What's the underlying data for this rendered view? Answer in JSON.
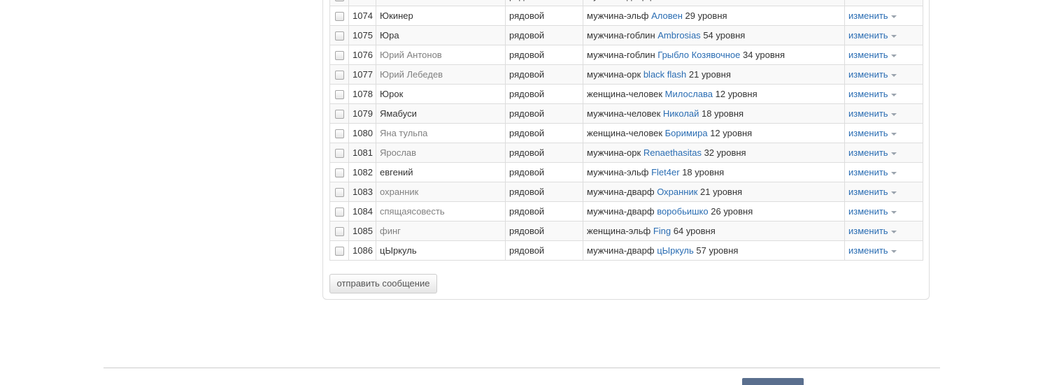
{
  "members": [
    {
      "num": "",
      "name": "",
      "name_link": false,
      "rank": "рядовой",
      "race": "мужчина-дварф",
      "char": "",
      "level": "",
      "action": "изменить"
    },
    {
      "num": "1074",
      "name": "Юкинер",
      "name_link": true,
      "rank": "рядовой",
      "race": "мужчина-эльф",
      "char": "Аловен",
      "level": "29 уровня",
      "action": "изменить"
    },
    {
      "num": "1075",
      "name": "Юра",
      "name_link": true,
      "rank": "рядовой",
      "race": "мужчина-гоблин",
      "char": "Ambrosias",
      "level": "54 уровня",
      "action": "изменить"
    },
    {
      "num": "1076",
      "name": "Юрий Антонов",
      "name_link": false,
      "rank": "рядовой",
      "race": "мужчина-гоблин",
      "char": "Грыбло Козявочное",
      "level": "34 уровня",
      "action": "изменить"
    },
    {
      "num": "1077",
      "name": "Юрий Лебедев",
      "name_link": false,
      "rank": "рядовой",
      "race": "мужчина-орк",
      "char": "black flash",
      "level": "21 уровня",
      "action": "изменить"
    },
    {
      "num": "1078",
      "name": "Юрок",
      "name_link": true,
      "rank": "рядовой",
      "race": "женщина-человек",
      "char": "Милослава",
      "level": "12 уровня",
      "action": "изменить"
    },
    {
      "num": "1079",
      "name": "Ямабуси",
      "name_link": true,
      "rank": "рядовой",
      "race": "мужчина-человек",
      "char": "Николай",
      "level": "18 уровня",
      "action": "изменить"
    },
    {
      "num": "1080",
      "name": "Яна тульпа",
      "name_link": false,
      "rank": "рядовой",
      "race": "женщина-человек",
      "char": "Боримира",
      "level": "12 уровня",
      "action": "изменить"
    },
    {
      "num": "1081",
      "name": "Ярослав",
      "name_link": false,
      "rank": "рядовой",
      "race": "мужчина-орк",
      "char": "Renaethasitas",
      "level": "32 уровня",
      "action": "изменить"
    },
    {
      "num": "1082",
      "name": "евгений",
      "name_link": true,
      "rank": "рядовой",
      "race": "мужчина-эльф",
      "char": "Flet4er",
      "level": "18 уровня",
      "action": "изменить"
    },
    {
      "num": "1083",
      "name": "охранник",
      "name_link": false,
      "rank": "рядовой",
      "race": "мужчина-дварф",
      "char": "Охранник",
      "level": "21 уровня",
      "action": "изменить"
    },
    {
      "num": "1084",
      "name": "спящаясовесть",
      "name_link": false,
      "rank": "рядовой",
      "race": "мужчина-дварф",
      "char": "воробьишко",
      "level": "26 уровня",
      "action": "изменить"
    },
    {
      "num": "1085",
      "name": "финг",
      "name_link": false,
      "rank": "рядовой",
      "race": "женщина-эльф",
      "char": "Fing",
      "level": "64 уровня",
      "action": "изменить"
    },
    {
      "num": "1086",
      "name": "цЫркуль",
      "name_link": true,
      "rank": "рядовой",
      "race": "мужчина-дварф",
      "char": "цЫркуль",
      "level": "57 уровня",
      "action": "изменить"
    }
  ],
  "send_button": "отправить сообщение",
  "colors": {
    "link": "#2a6db3",
    "muted": "#808080",
    "footer_box": "#5a6f8e"
  }
}
